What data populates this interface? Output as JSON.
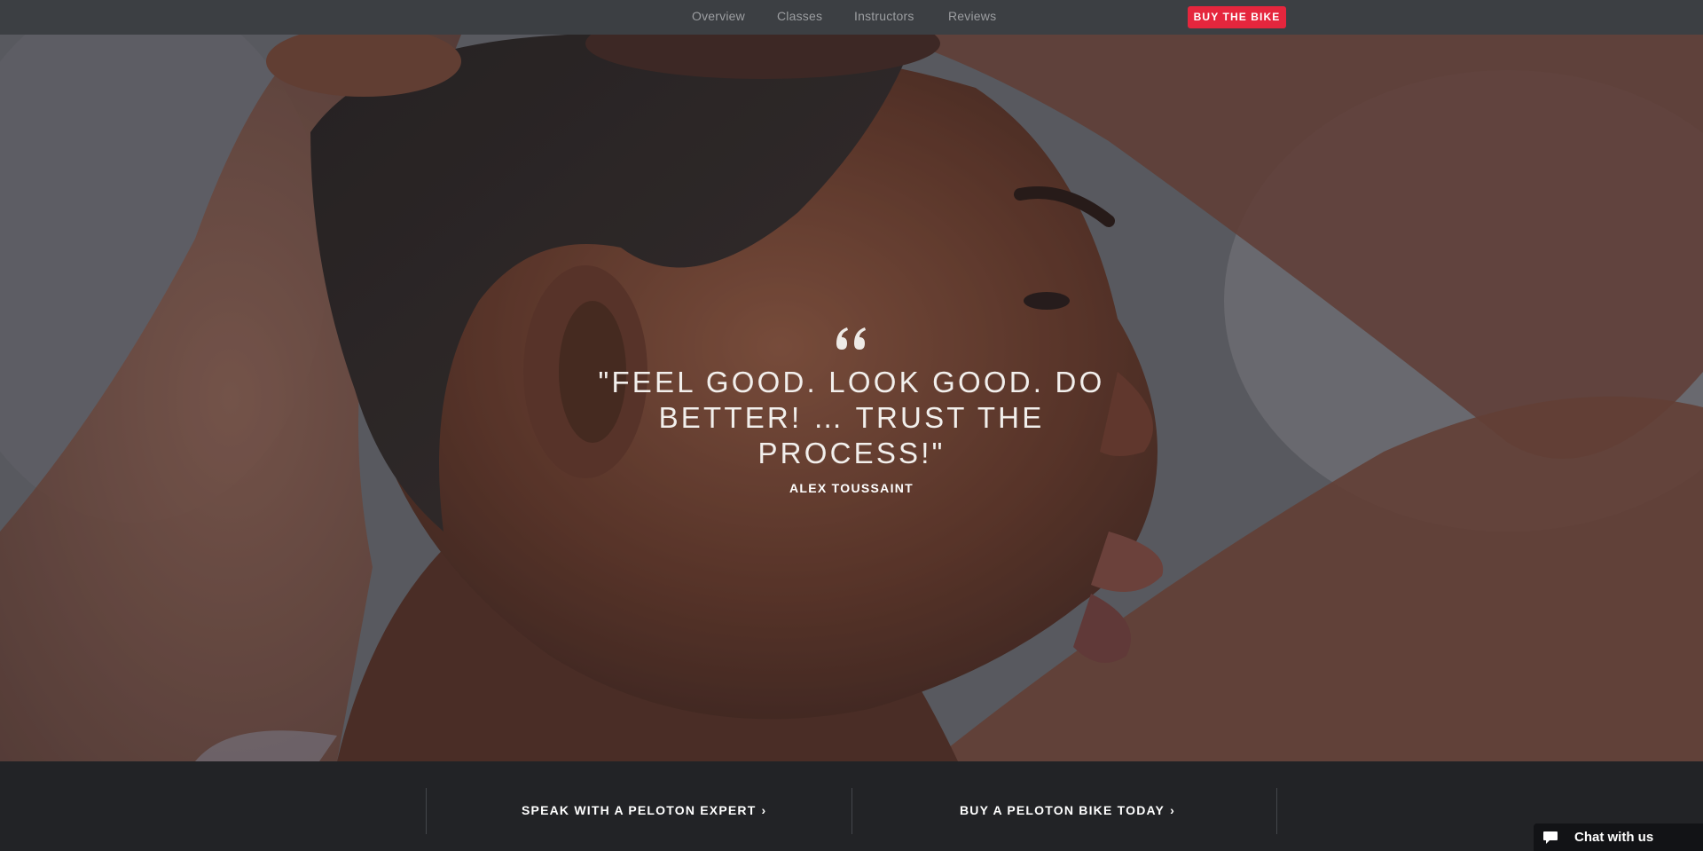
{
  "nav": {
    "links": [
      "Overview",
      "Classes",
      "Instructors",
      "Reviews"
    ],
    "buy_label": "BUY THE BIKE",
    "buy_color": "#e5263d"
  },
  "hero": {
    "quote_icon": "quote-mark-icon",
    "quote": "\"FEEL GOOD. LOOK GOOD. DO BETTER!  … TRUST THE PROCESS!\"",
    "author": "ALEX TOUSSAINT"
  },
  "bottom": {
    "cta_expert": "SPEAK WITH A PELOTON EXPERT",
    "cta_buy": "BUY A PELOTON BIKE TODAY",
    "chevron_icon": "chevron-right-icon"
  },
  "chat": {
    "icon": "chat-bubble-icon",
    "label": "Chat with us"
  }
}
